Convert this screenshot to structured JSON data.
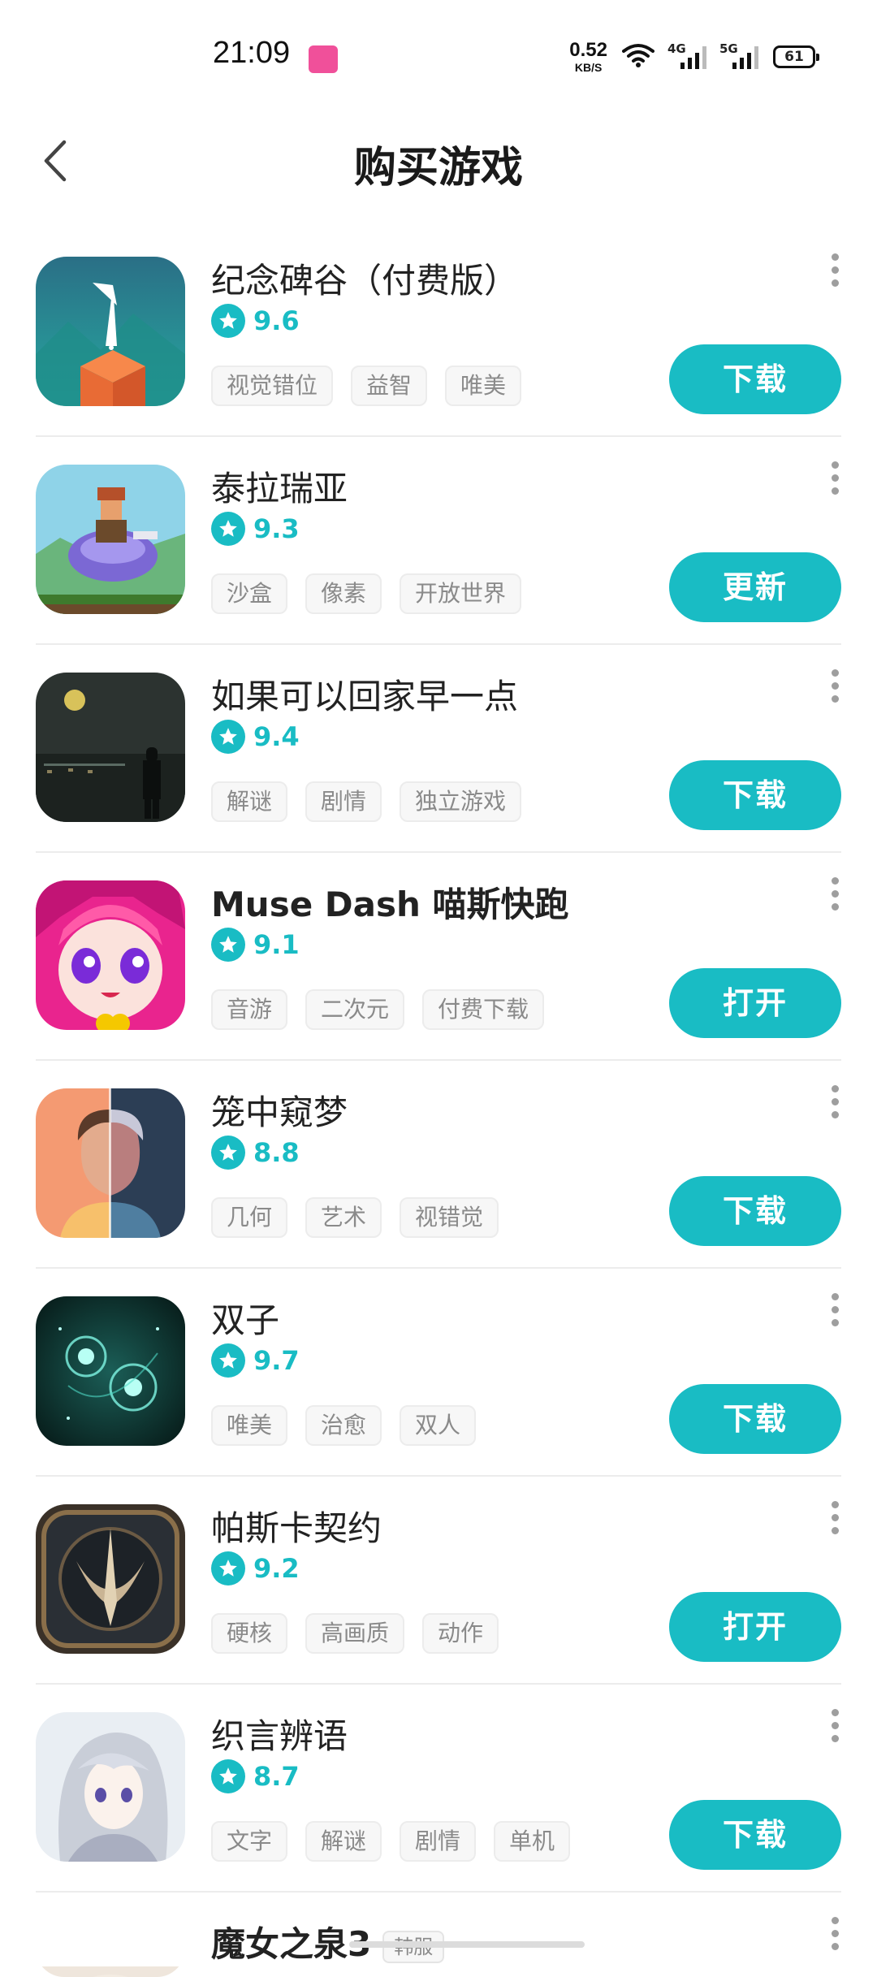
{
  "status_bar": {
    "time": "21:09",
    "net_speed": "0.52",
    "net_speed_unit": "KB/S",
    "sim1": "4G",
    "sim2": "5G",
    "battery": "61"
  },
  "header": {
    "title": "购买游戏",
    "back_icon": "chevron-left-icon"
  },
  "accent_color": "#19bcc4",
  "games": [
    {
      "name": "纪念碑谷（付费版）",
      "rating": "9.6",
      "tags": [
        "视觉错位",
        "益智",
        "唯美"
      ],
      "action": "下载"
    },
    {
      "name": "泰拉瑞亚",
      "rating": "9.3",
      "tags": [
        "沙盒",
        "像素",
        "开放世界"
      ],
      "action": "更新"
    },
    {
      "name": "如果可以回家早一点",
      "rating": "9.4",
      "tags": [
        "解谜",
        "剧情",
        "独立游戏"
      ],
      "action": "下载"
    },
    {
      "name": "Muse Dash 喵斯快跑",
      "rating": "9.1",
      "tags": [
        "音游",
        "二次元",
        "付费下载"
      ],
      "action": "打开"
    },
    {
      "name": "笼中窥梦",
      "rating": "8.8",
      "tags": [
        "几何",
        "艺术",
        "视错觉"
      ],
      "action": "下载"
    },
    {
      "name": "双子",
      "rating": "9.7",
      "tags": [
        "唯美",
        "治愈",
        "双人"
      ],
      "action": "下载"
    },
    {
      "name": "帕斯卡契约",
      "rating": "9.2",
      "tags": [
        "硬核",
        "高画质",
        "动作"
      ],
      "action": "打开"
    },
    {
      "name": "织言辨语",
      "rating": "8.7",
      "tags": [
        "文字",
        "解谜",
        "剧情",
        "单机"
      ],
      "action": "下载"
    }
  ],
  "partial_game": {
    "name": "魔女之泉3",
    "badge": "韩服"
  }
}
